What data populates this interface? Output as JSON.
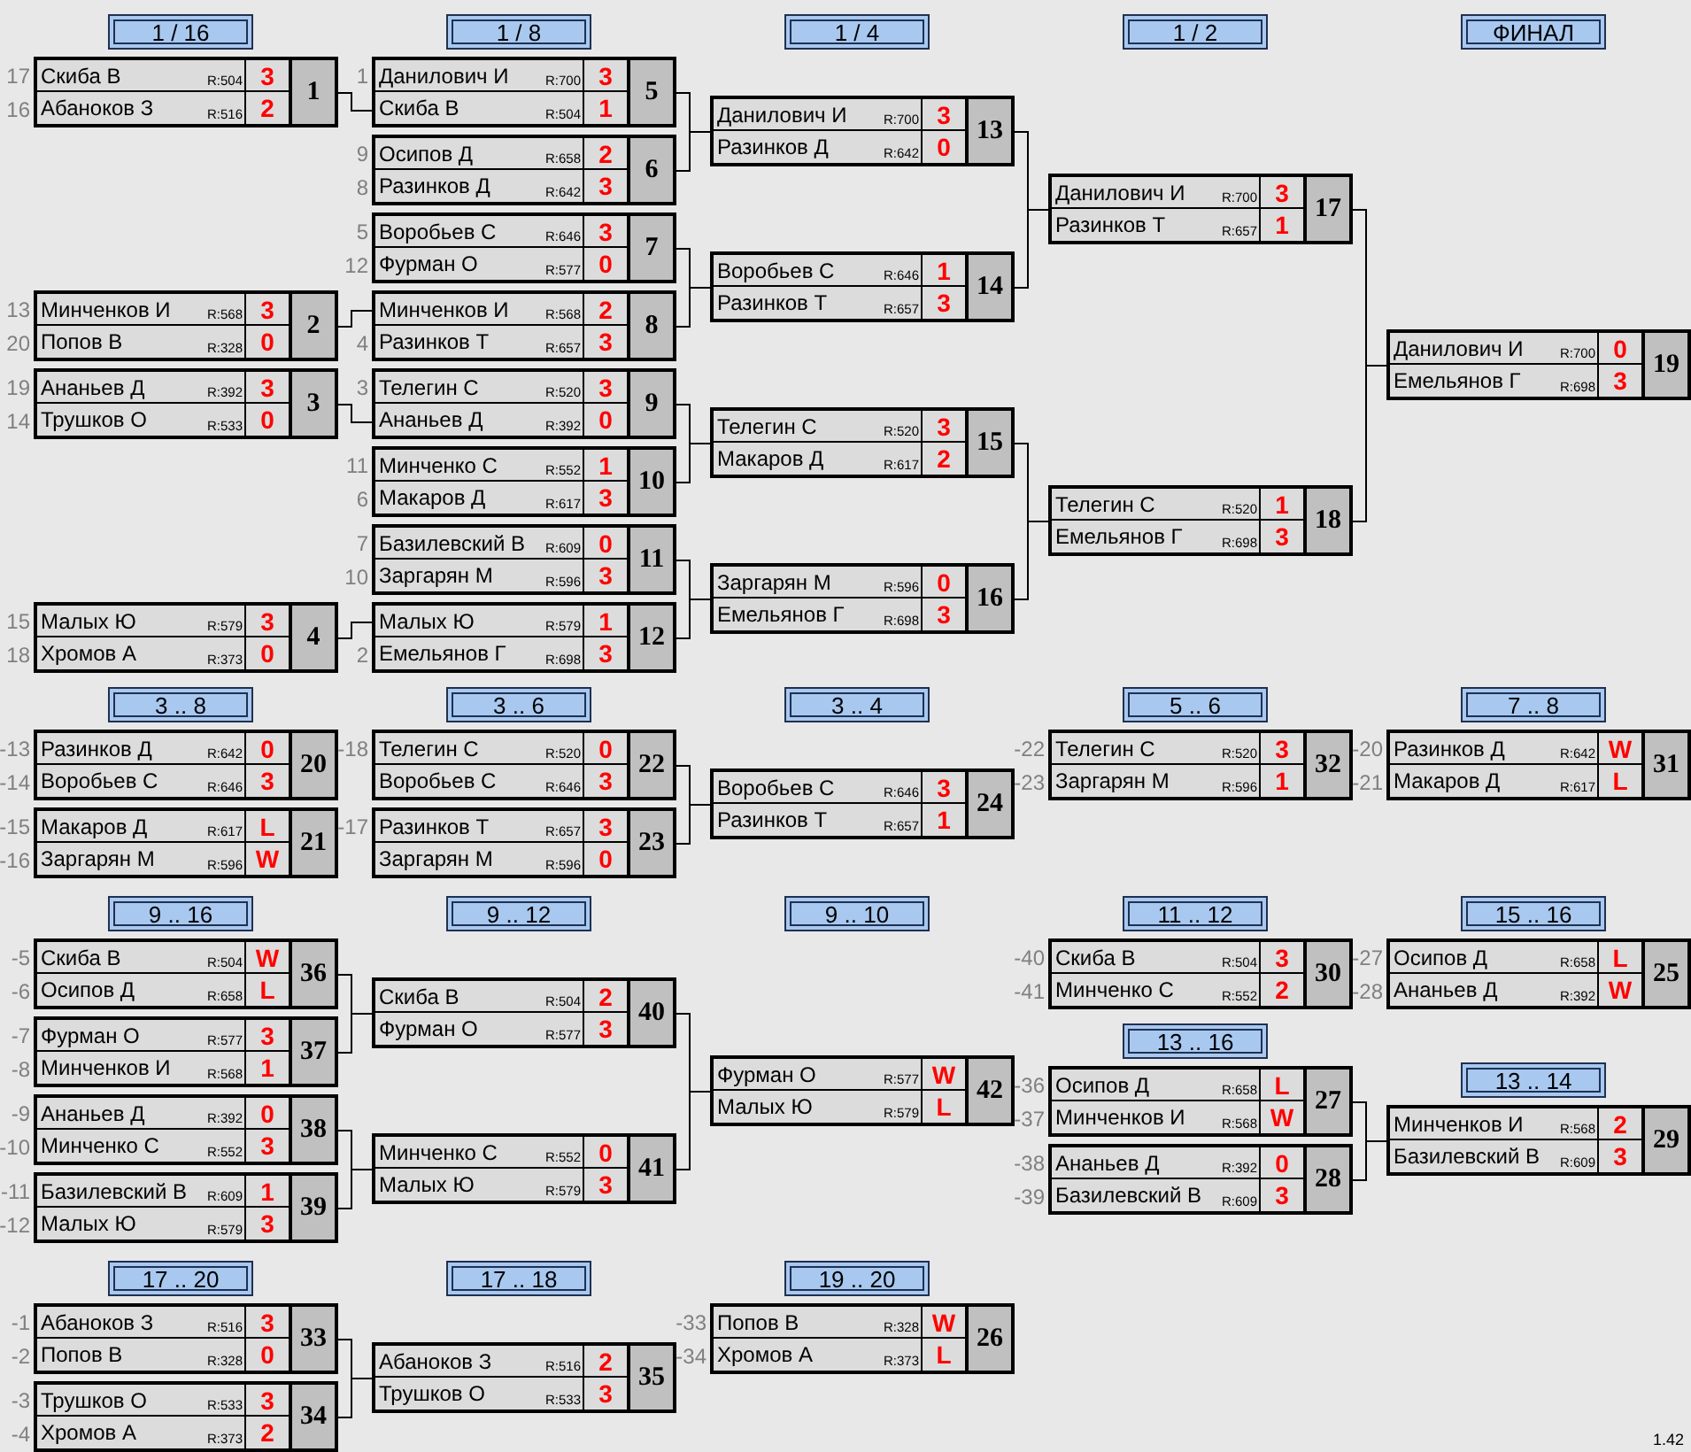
{
  "stages": [
    {
      "title": "1 / 16",
      "matches": [
        {
          "number": "1",
          "players": [
            {
              "seed": "17",
              "name": "Скиба В",
              "rating": "R:504",
              "score": "3"
            },
            {
              "seed": "16",
              "name": "Абаноков З",
              "rating": "R:516",
              "score": "2"
            }
          ]
        },
        {
          "number": "2",
          "players": [
            {
              "seed": "13",
              "name": "Минченков И",
              "rating": "R:568",
              "score": "3"
            },
            {
              "seed": "20",
              "name": "Попов В",
              "rating": "R:328",
              "score": "0"
            }
          ]
        },
        {
          "number": "3",
          "players": [
            {
              "seed": "19",
              "name": "Ананьев Д",
              "rating": "R:392",
              "score": "3"
            },
            {
              "seed": "14",
              "name": "Трушков О",
              "rating": "R:533",
              "score": "0"
            }
          ]
        },
        {
          "number": "4",
          "players": [
            {
              "seed": "15",
              "name": "Малых Ю",
              "rating": "R:579",
              "score": "3"
            },
            {
              "seed": "18",
              "name": "Хромов А",
              "rating": "R:373",
              "score": "0"
            }
          ]
        }
      ]
    },
    {
      "title": "1 / 8",
      "matches": [
        {
          "number": "5",
          "players": [
            {
              "seed": "1",
              "name": "Данилович И",
              "rating": "R:700",
              "score": "3"
            },
            {
              "name": "Скиба В",
              "rating": "R:504",
              "score": "1"
            }
          ]
        },
        {
          "number": "6",
          "players": [
            {
              "seed": "9",
              "name": "Осипов Д",
              "rating": "R:658",
              "score": "2"
            },
            {
              "seed": "8",
              "name": "Разинков Д",
              "rating": "R:642",
              "score": "3"
            }
          ]
        },
        {
          "number": "7",
          "players": [
            {
              "seed": "5",
              "name": "Воробьев С",
              "rating": "R:646",
              "score": "3"
            },
            {
              "seed": "12",
              "name": "Фурман О",
              "rating": "R:577",
              "score": "0"
            }
          ]
        },
        {
          "number": "8",
          "players": [
            {
              "name": "Минченков И",
              "rating": "R:568",
              "score": "2"
            },
            {
              "seed": "4",
              "name": "Разинков Т",
              "rating": "R:657",
              "score": "3"
            }
          ]
        },
        {
          "number": "9",
          "players": [
            {
              "seed": "3",
              "name": "Телегин С",
              "rating": "R:520",
              "score": "3"
            },
            {
              "name": "Ананьев Д",
              "rating": "R:392",
              "score": "0"
            }
          ]
        },
        {
          "number": "10",
          "players": [
            {
              "seed": "11",
              "name": "Минченко С",
              "rating": "R:552",
              "score": "1"
            },
            {
              "seed": "6",
              "name": "Макаров Д",
              "rating": "R:617",
              "score": "3"
            }
          ]
        },
        {
          "number": "11",
          "players": [
            {
              "seed": "7",
              "name": "Базилевский В",
              "rating": "R:609",
              "score": "0"
            },
            {
              "seed": "10",
              "name": "Заргарян М",
              "rating": "R:596",
              "score": "3"
            }
          ]
        },
        {
          "number": "12",
          "players": [
            {
              "name": "Малых Ю",
              "rating": "R:579",
              "score": "1"
            },
            {
              "seed": "2",
              "name": "Емельянов Г",
              "rating": "R:698",
              "score": "3"
            }
          ]
        }
      ]
    },
    {
      "title": "1 / 4",
      "matches": [
        {
          "number": "13",
          "players": [
            {
              "name": "Данилович И",
              "rating": "R:700",
              "score": "3"
            },
            {
              "name": "Разинков Д",
              "rating": "R:642",
              "score": "0"
            }
          ]
        },
        {
          "number": "14",
          "players": [
            {
              "name": "Воробьев С",
              "rating": "R:646",
              "score": "1"
            },
            {
              "name": "Разинков Т",
              "rating": "R:657",
              "score": "3"
            }
          ]
        },
        {
          "number": "15",
          "players": [
            {
              "name": "Телегин С",
              "rating": "R:520",
              "score": "3"
            },
            {
              "name": "Макаров Д",
              "rating": "R:617",
              "score": "2"
            }
          ]
        },
        {
          "number": "16",
          "players": [
            {
              "name": "Заргарян М",
              "rating": "R:596",
              "score": "0"
            },
            {
              "name": "Емельянов Г",
              "rating": "R:698",
              "score": "3"
            }
          ]
        }
      ]
    },
    {
      "title": "1 / 2",
      "matches": [
        {
          "number": "17",
          "players": [
            {
              "name": "Данилович И",
              "rating": "R:700",
              "score": "3"
            },
            {
              "name": "Разинков Т",
              "rating": "R:657",
              "score": "1"
            }
          ]
        },
        {
          "number": "18",
          "players": [
            {
              "name": "Телегин С",
              "rating": "R:520",
              "score": "1"
            },
            {
              "name": "Емельянов Г",
              "rating": "R:698",
              "score": "3"
            }
          ]
        }
      ]
    },
    {
      "title": "ФИНАЛ",
      "matches": [
        {
          "number": "19",
          "players": [
            {
              "name": "Данилович И",
              "rating": "R:700",
              "score": "0"
            },
            {
              "name": "Емельянов Г",
              "rating": "R:698",
              "score": "3"
            }
          ]
        }
      ]
    },
    {
      "title": "3 .. 8",
      "matches": [
        {
          "number": "20",
          "players": [
            {
              "seed": "-13",
              "name": "Разинков Д",
              "rating": "R:642",
              "score": "0"
            },
            {
              "seed": "-14",
              "name": "Воробьев С",
              "rating": "R:646",
              "score": "3"
            }
          ]
        },
        {
          "number": "21",
          "players": [
            {
              "seed": "-15",
              "name": "Макаров Д",
              "rating": "R:617",
              "score": "L"
            },
            {
              "seed": "-16",
              "name": "Заргарян М",
              "rating": "R:596",
              "score": "W"
            }
          ]
        }
      ]
    },
    {
      "title": "3 .. 6",
      "matches": [
        {
          "number": "22",
          "players": [
            {
              "seed": "-18",
              "name": "Телегин С",
              "rating": "R:520",
              "score": "0"
            },
            {
              "name": "Воробьев С",
              "rating": "R:646",
              "score": "3"
            }
          ]
        },
        {
          "number": "23",
          "players": [
            {
              "seed": "-17",
              "name": "Разинков Т",
              "rating": "R:657",
              "score": "3"
            },
            {
              "name": "Заргарян М",
              "rating": "R:596",
              "score": "0"
            }
          ]
        }
      ]
    },
    {
      "title": "3 .. 4",
      "matches": [
        {
          "number": "24",
          "players": [
            {
              "name": "Воробьев С",
              "rating": "R:646",
              "score": "3"
            },
            {
              "name": "Разинков Т",
              "rating": "R:657",
              "score": "1"
            }
          ]
        }
      ]
    },
    {
      "title": "5 .. 6",
      "matches": [
        {
          "number": "32",
          "players": [
            {
              "seed": "-22",
              "name": "Телегин С",
              "rating": "R:520",
              "score": "3"
            },
            {
              "seed": "-23",
              "name": "Заргарян М",
              "rating": "R:596",
              "score": "1"
            }
          ]
        }
      ]
    },
    {
      "title": "7 .. 8",
      "matches": [
        {
          "number": "31",
          "players": [
            {
              "seed": "-20",
              "name": "Разинков Д",
              "rating": "R:642",
              "score": "W"
            },
            {
              "seed": "-21",
              "name": "Макаров Д",
              "rating": "R:617",
              "score": "L"
            }
          ]
        }
      ]
    },
    {
      "title": "9 .. 16",
      "matches": [
        {
          "number": "36",
          "players": [
            {
              "seed": "-5",
              "name": "Скиба В",
              "rating": "R:504",
              "score": "W"
            },
            {
              "seed": "-6",
              "name": "Осипов Д",
              "rating": "R:658",
              "score": "L"
            }
          ]
        },
        {
          "number": "37",
          "players": [
            {
              "seed": "-7",
              "name": "Фурман О",
              "rating": "R:577",
              "score": "3"
            },
            {
              "seed": "-8",
              "name": "Минченков И",
              "rating": "R:568",
              "score": "1"
            }
          ]
        },
        {
          "number": "38",
          "players": [
            {
              "seed": "-9",
              "name": "Ананьев Д",
              "rating": "R:392",
              "score": "0"
            },
            {
              "seed": "-10",
              "name": "Минченко С",
              "rating": "R:552",
              "score": "3"
            }
          ]
        },
        {
          "number": "39",
          "players": [
            {
              "seed": "-11",
              "name": "Базилевский В",
              "rating": "R:609",
              "score": "1"
            },
            {
              "seed": "-12",
              "name": "Малых Ю",
              "rating": "R:579",
              "score": "3"
            }
          ]
        }
      ]
    },
    {
      "title": "9 .. 12",
      "matches": [
        {
          "number": "40",
          "players": [
            {
              "name": "Скиба В",
              "rating": "R:504",
              "score": "2"
            },
            {
              "name": "Фурман О",
              "rating": "R:577",
              "score": "3"
            }
          ]
        },
        {
          "number": "41",
          "players": [
            {
              "name": "Минченко С",
              "rating": "R:552",
              "score": "0"
            },
            {
              "name": "Малых Ю",
              "rating": "R:579",
              "score": "3"
            }
          ]
        }
      ]
    },
    {
      "title": "9 .. 10",
      "matches": [
        {
          "number": "42",
          "players": [
            {
              "name": "Фурман О",
              "rating": "R:577",
              "score": "W"
            },
            {
              "name": "Малых Ю",
              "rating": "R:579",
              "score": "L"
            }
          ]
        }
      ]
    },
    {
      "title": "11 .. 12",
      "matches": [
        {
          "number": "30",
          "players": [
            {
              "seed": "-40",
              "name": "Скиба В",
              "rating": "R:504",
              "score": "3"
            },
            {
              "seed": "-41",
              "name": "Минченко С",
              "rating": "R:552",
              "score": "2"
            }
          ]
        }
      ]
    },
    {
      "title": "15 .. 16",
      "matches": [
        {
          "number": "25",
          "players": [
            {
              "seed": "-27",
              "name": "Осипов Д",
              "rating": "R:658",
              "score": "L"
            },
            {
              "seed": "-28",
              "name": "Ананьев Д",
              "rating": "R:392",
              "score": "W"
            }
          ]
        }
      ]
    },
    {
      "title": "13 .. 16",
      "matches": [
        {
          "number": "27",
          "players": [
            {
              "seed": "-36",
              "name": "Осипов Д",
              "rating": "R:658",
              "score": "L"
            },
            {
              "seed": "-37",
              "name": "Минченков И",
              "rating": "R:568",
              "score": "W"
            }
          ]
        },
        {
          "number": "28",
          "players": [
            {
              "seed": "-38",
              "name": "Ананьев Д",
              "rating": "R:392",
              "score": "0"
            },
            {
              "seed": "-39",
              "name": "Базилевский В",
              "rating": "R:609",
              "score": "3"
            }
          ]
        }
      ]
    },
    {
      "title": "13 .. 14",
      "matches": [
        {
          "number": "29",
          "players": [
            {
              "name": "Минченков И",
              "rating": "R:568",
              "score": "2"
            },
            {
              "name": "Базилевский В",
              "rating": "R:609",
              "score": "3"
            }
          ]
        }
      ]
    },
    {
      "title": "17 .. 20",
      "matches": [
        {
          "number": "33",
          "players": [
            {
              "seed": "-1",
              "name": "Абаноков З",
              "rating": "R:516",
              "score": "3"
            },
            {
              "seed": "-2",
              "name": "Попов В",
              "rating": "R:328",
              "score": "0"
            }
          ]
        },
        {
          "number": "34",
          "players": [
            {
              "seed": "-3",
              "name": "Трушков О",
              "rating": "R:533",
              "score": "3"
            },
            {
              "seed": "-4",
              "name": "Хромов А",
              "rating": "R:373",
              "score": "2"
            }
          ]
        }
      ]
    },
    {
      "title": "17 .. 18",
      "matches": [
        {
          "number": "35",
          "players": [
            {
              "name": "Абаноков З",
              "rating": "R:516",
              "score": "2"
            },
            {
              "name": "Трушков О",
              "rating": "R:533",
              "score": "3"
            }
          ]
        }
      ]
    },
    {
      "title": "19 .. 20",
      "matches": [
        {
          "number": "26",
          "players": [
            {
              "seed": "-33",
              "name": "Попов В",
              "rating": "R:328",
              "score": "W"
            },
            {
              "seed": "-34",
              "name": "Хромов А",
              "rating": "R:373",
              "score": "L"
            }
          ]
        }
      ]
    }
  ],
  "version": "1.42"
}
